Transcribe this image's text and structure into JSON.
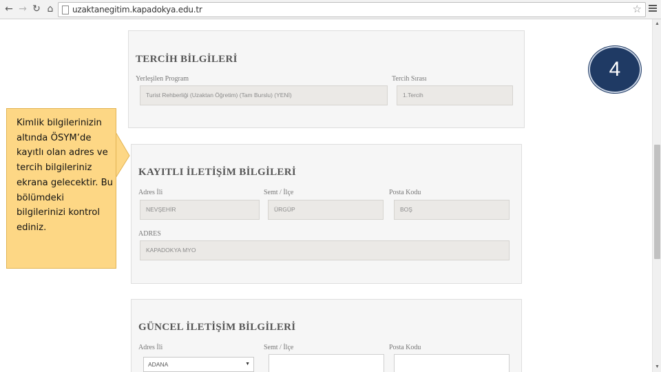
{
  "browser": {
    "url": "uzaktanegitim.kapadokya.edu.tr",
    "icons": {
      "back": "back-arrow-icon",
      "forward": "forward-arrow-icon",
      "reload": "reload-icon",
      "home": "home-icon",
      "page": "page-icon",
      "bookmark": "star-icon",
      "menu": "menu-icon"
    }
  },
  "step_badge": {
    "number": "4",
    "color": "#1f3a64"
  },
  "callout": {
    "text": "Kimlik bilgilerinizin altında ÖSYM’de kayıtlı olan adres ve tercih bilgileriniz ekrana gelecektir. Bu bölümdeki bilgilerinizi kontrol ediniz.",
    "color": "#fdd785"
  },
  "tercih": {
    "title": "TERCİH BİLGİLERİ",
    "program_label": "Yerleşilen Program",
    "program_value": "Turist Rehberliği (Uzaktan Öğretim) (Tam Burslu) (YENİ)",
    "sira_label": "Tercih Sırası",
    "sira_value": "1.Tercih"
  },
  "kayitli": {
    "title": "KAYITLI İLETİŞİM BİLGİLERİ",
    "il_label": "Adres İli",
    "il_value": "NEVŞEHİR",
    "ilce_label": "Semt / İlçe",
    "ilce_value": "ÜRGÜP",
    "posta_label": "Posta Kodu",
    "posta_value": "BOŞ",
    "adres_label": "ADRES",
    "adres_value": "KAPADOKYA MYO"
  },
  "guncel": {
    "title": "GÜNCEL İLETİŞİM BİLGİLERİ",
    "il_label": "Adres İli",
    "il_selected": "ADANA",
    "ilce_label": "Semt / İlçe",
    "ilce_value": "",
    "posta_label": "Posta Kodu",
    "posta_value": ""
  }
}
